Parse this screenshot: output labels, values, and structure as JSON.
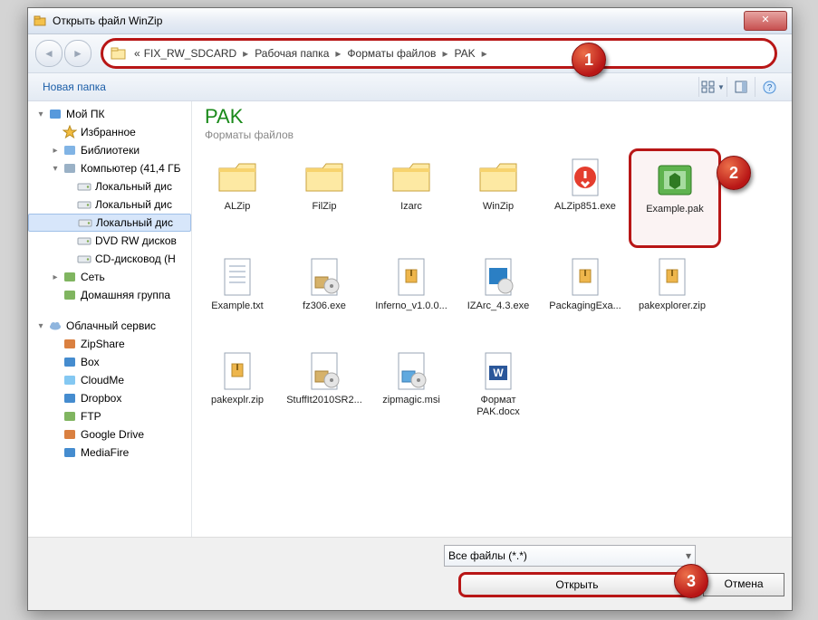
{
  "window": {
    "title": "Открыть файл WinZip"
  },
  "breadcrumb": {
    "prefix": "«",
    "parts": [
      "FIX_RW_SDCARD",
      "Рабочая папка",
      "Форматы файлов",
      "PAK"
    ]
  },
  "toolbar": {
    "newfolder": "Новая папка"
  },
  "folder_header": {
    "title": "PAK",
    "subtitle": "Форматы файлов"
  },
  "sidebar": {
    "items": [
      {
        "label": "Мой ПК",
        "lvl": 0,
        "icon": "pc",
        "tw": "▾"
      },
      {
        "label": "Избранное",
        "lvl": 1,
        "icon": "star",
        "tw": ""
      },
      {
        "label": "Библиотеки",
        "lvl": 1,
        "icon": "lib",
        "tw": "▸"
      },
      {
        "label": "Компьютер (41,4 ГБ",
        "lvl": 1,
        "icon": "comp",
        "tw": "▾"
      },
      {
        "label": "Локальный дис",
        "lvl": 2,
        "icon": "drive",
        "tw": "",
        "sel": false
      },
      {
        "label": "Локальный дис",
        "lvl": 2,
        "icon": "drive",
        "tw": ""
      },
      {
        "label": "Локальный дис",
        "lvl": 2,
        "icon": "drive",
        "tw": "",
        "sel": true
      },
      {
        "label": "DVD RW дисков",
        "lvl": 2,
        "icon": "dvd",
        "tw": ""
      },
      {
        "label": "CD-дисковод (H",
        "lvl": 2,
        "icon": "cd",
        "tw": ""
      },
      {
        "label": "Сеть",
        "lvl": 1,
        "icon": "net",
        "tw": "▸"
      },
      {
        "label": "Домашняя группа",
        "lvl": 1,
        "icon": "home",
        "tw": ""
      },
      {
        "label": "",
        "lvl": 0,
        "spacer": true
      },
      {
        "label": "Облачный сервис",
        "lvl": 0,
        "icon": "cloud",
        "tw": "▾"
      },
      {
        "label": "ZipShare",
        "lvl": 1,
        "icon": "zs",
        "tw": ""
      },
      {
        "label": "Box",
        "lvl": 1,
        "icon": "box",
        "tw": ""
      },
      {
        "label": "CloudMe",
        "lvl": 1,
        "icon": "cm",
        "tw": ""
      },
      {
        "label": "Dropbox",
        "lvl": 1,
        "icon": "db",
        "tw": ""
      },
      {
        "label": "FTP",
        "lvl": 1,
        "icon": "ftp",
        "tw": ""
      },
      {
        "label": "Google Drive",
        "lvl": 1,
        "icon": "gd",
        "tw": ""
      },
      {
        "label": "MediaFire",
        "lvl": 1,
        "icon": "mf",
        "tw": ""
      }
    ]
  },
  "files": [
    {
      "name": "ALZip",
      "icon": "folder"
    },
    {
      "name": "FilZip",
      "icon": "folder"
    },
    {
      "name": "Izarc",
      "icon": "folder"
    },
    {
      "name": "WinZip",
      "icon": "folder"
    },
    {
      "name": "ALZip851.exe",
      "icon": "exe-red"
    },
    {
      "name": "Example.pak",
      "icon": "pak",
      "sel": true
    },
    {
      "name": "Example.txt",
      "icon": "txt"
    },
    {
      "name": "fz306.exe",
      "icon": "exe-box"
    },
    {
      "name": "Inferno_v1.0.0...",
      "icon": "zip"
    },
    {
      "name": "IZArc_4.3.exe",
      "icon": "exe-blue"
    },
    {
      "name": "PackagingExa...",
      "icon": "zip"
    },
    {
      "name": "pakexplorer.zip",
      "icon": "zip"
    },
    {
      "name": "pakexplr.zip",
      "icon": "zip"
    },
    {
      "name": "StuffIt2010SR2...",
      "icon": "exe-box"
    },
    {
      "name": "zipmagic.msi",
      "icon": "msi"
    },
    {
      "name": "Формат PAK.docx",
      "icon": "docx"
    }
  ],
  "filetype": {
    "label": "Все файлы (*.*)"
  },
  "buttons": {
    "open": "Открыть",
    "cancel": "Отмена"
  },
  "annotations": {
    "a1": "1",
    "a2": "2",
    "a3": "3"
  }
}
